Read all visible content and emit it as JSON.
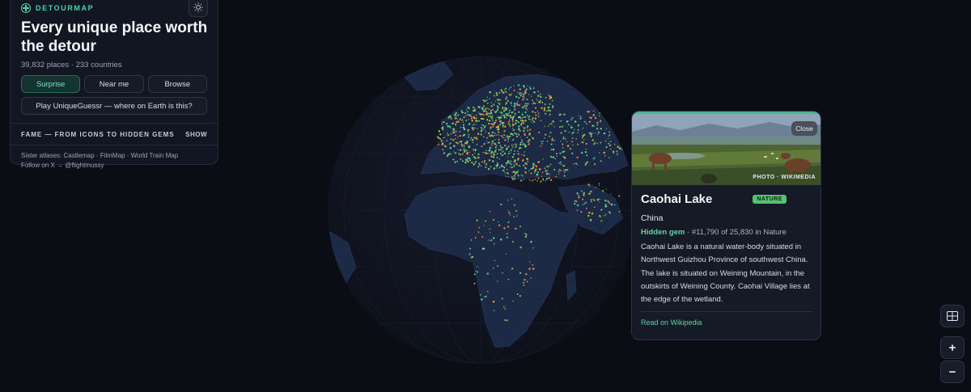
{
  "colors": {
    "accent": "#4fd1a5",
    "land": "#1d2a45",
    "ocean": "#0b0d14",
    "nature_badge": "#56c074"
  },
  "sidebar": {
    "brand": "DETOURMAP",
    "headline": "Every unique place worth the detour",
    "stats": "39,832 places · 233 countries",
    "buttons": {
      "surprise": "Surprise",
      "near_me": "Near me",
      "browse": "Browse"
    },
    "game_button": "Play UniqueGuessr — where on Earth is this?",
    "fame": {
      "label": "FAME — FROM ICONS TO HIDDEN GEMS",
      "toggle": "SHOW"
    },
    "footer": {
      "sister": "Sister atlases: Castlemap · FilmMap · World Train Map",
      "follow": "Follow on X → @flightmussy"
    },
    "theme_icon": "sun-icon"
  },
  "card": {
    "close_label": "Close",
    "photo_credit": "PHOTO · WIKIMEDIA",
    "title": "Caohai Lake",
    "category": "NATURE",
    "country": "China",
    "rank_label": "Hidden gem",
    "rank_detail": " · #11,790 of 25,830 in Nature",
    "description": "Caohai Lake is a natural water-body situated in Northwest Guizhou Province of southwest China. The lake is situated on Weining Mountain, in the outskirts of Weining County. Caohai Village lies at the edge of the wetland.",
    "wiki_link": "Read on Wikipedia"
  },
  "controls": {
    "zoom_in": "+",
    "zoom_out": "−",
    "layers_icon": "grid-icon"
  }
}
